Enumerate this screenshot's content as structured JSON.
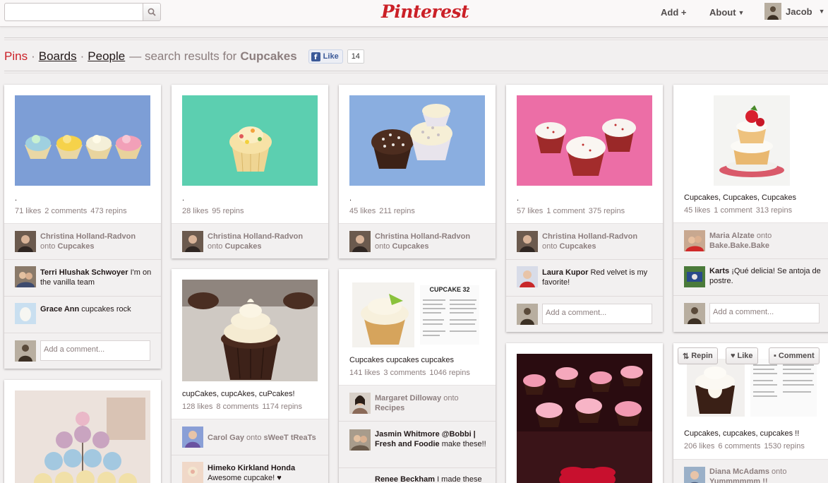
{
  "header": {
    "search_placeholder": "",
    "logo": "Pinterest",
    "add_label": "Add",
    "add_sym": "+",
    "about_label": "About",
    "user_name": "Jacob"
  },
  "filter": {
    "pins": "Pins",
    "boards": "Boards",
    "people": "People",
    "dot": "·",
    "description": "— search results for",
    "term": "Cupcakes",
    "like_label": "Like",
    "like_count": "14"
  },
  "pins": [
    {
      "desc": ".",
      "likes": "71 likes",
      "comments": "2 comments",
      "repins": "473 repins",
      "pinner": "Christina Holland-Radvon",
      "onto": "onto",
      "board": "Cupcakes",
      "comments_list": [
        {
          "name": "Terri Hlushak Schwoyer",
          "text": "I'm on the vanilla team"
        },
        {
          "name": "Grace Ann",
          "text": "cupcakes rock"
        }
      ],
      "add_comment": "Add a comment..."
    },
    {
      "desc": ".",
      "likes": "28 likes",
      "repins": "95 repins",
      "pinner": "Christina Holland-Radvon",
      "onto": "onto",
      "board": "Cupcakes"
    },
    {
      "desc": ".",
      "likes": "45 likes",
      "repins": "211 repins",
      "pinner": "Christina Holland-Radvon",
      "onto": "onto",
      "board": "Cupcakes"
    },
    {
      "desc": ".",
      "likes": "57 likes",
      "comments": "1 comment",
      "repins": "375 repins",
      "pinner": "Christina Holland-Radvon",
      "onto": "onto",
      "board": "Cupcakes",
      "comments_list": [
        {
          "name": "Laura Kupor",
          "text": "Red velvet is my favorite!"
        }
      ],
      "add_comment": "Add a comment..."
    },
    {
      "desc": "Cupcakes, Cupcakes, Cupcakes",
      "likes": "45 likes",
      "comments": "1 comment",
      "repins": "313 repins",
      "pinner": "Maria Alzate",
      "onto": "onto",
      "board": "Bake.Bake.Bake",
      "comments_list": [
        {
          "name": "Karts",
          "text": "¡Qué delicia! Se antoja de postre."
        }
      ],
      "add_comment": "Add a comment..."
    },
    {
      "desc": "cupCakes, cupcAkes, cuPcakes!",
      "likes": "128 likes",
      "comments": "8 comments",
      "repins": "1174 repins",
      "pinner": "Carol Gay",
      "onto": "onto",
      "board": "sWeeT tReaTs",
      "comments_list": [
        {
          "name": "Himeko Kirkland Honda",
          "text": "Awesome cupcake! ♥"
        }
      ]
    },
    {
      "desc": "Cupcakes cupcakes cupcakes",
      "likes": "141 likes",
      "comments": "3 comments",
      "repins": "1046 repins",
      "pinner": "Margaret Dilloway",
      "onto": "onto",
      "board": "Recipes",
      "recipe_title": "CUPCAKE 32",
      "comments_list": [
        {
          "name": "Jasmin Whitmore @Bobbi | Fresh and Foodie",
          "text": "make these!!"
        },
        {
          "name": "Renee Beckham",
          "text": "I made these"
        }
      ]
    },
    {
      "desc": "Cupcakes, cupcakes, cupcakes !!",
      "likes": "206 likes",
      "comments": "6 comments",
      "repins": "1530 repins",
      "pinner": "Diana McAdams",
      "onto": "onto",
      "board": "Yummmmmm !!",
      "repin_label": "Repin",
      "like_label": "Like",
      "comment_label": "Comment"
    }
  ],
  "colors": {
    "brand": "#cb2027",
    "text": "#524d4d",
    "muted": "#8c7e7e",
    "background": "#f2f0f0"
  }
}
